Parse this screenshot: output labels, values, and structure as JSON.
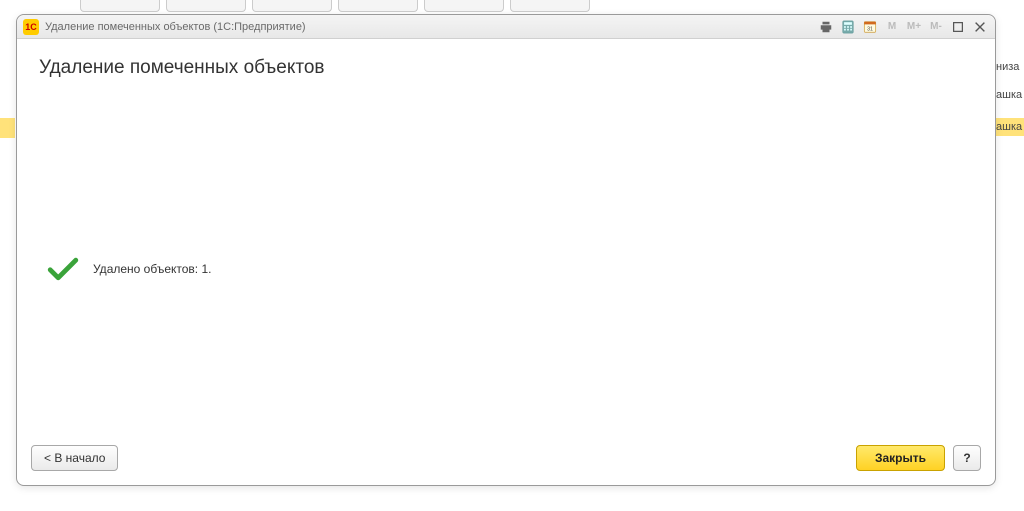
{
  "background": {
    "side_texts": [
      "низа",
      "ашка",
      "ашка"
    ]
  },
  "titlebar": {
    "title": "Удаление помеченных объектов (1С:Предприятие)",
    "m_labels": [
      "M",
      "M+",
      "M-"
    ]
  },
  "main": {
    "heading": "Удаление помеченных объектов",
    "status": "Удалено объектов: 1."
  },
  "footer": {
    "back": "< В начало",
    "close": "Закрыть",
    "help": "?"
  }
}
